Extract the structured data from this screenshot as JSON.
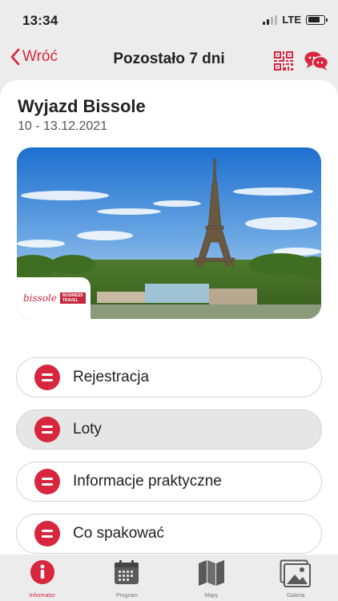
{
  "status_bar": {
    "time": "13:34",
    "network": "LTE"
  },
  "nav": {
    "back_label": "Wróć",
    "title": "Pozostało 7 dni"
  },
  "trip": {
    "title": "Wyjazd Bissole",
    "dates": "10 - 13.12.2021"
  },
  "hero": {
    "logo_word": "bissole",
    "logo_tag_line1": "BUSINESS",
    "logo_tag_line2": "TRAVEL"
  },
  "menu": {
    "items": [
      {
        "label": "Rejestracja",
        "active": false
      },
      {
        "label": "Loty",
        "active": true
      },
      {
        "label": "Informacje praktyczne",
        "active": false
      },
      {
        "label": "Co spakować",
        "active": false
      }
    ]
  },
  "tabs": [
    {
      "label": "Informator",
      "icon": "info-icon",
      "active": true
    },
    {
      "label": "Program",
      "icon": "calendar-icon",
      "active": false
    },
    {
      "label": "Mapy",
      "icon": "map-icon",
      "active": false
    },
    {
      "label": "Galeria",
      "icon": "gallery-icon",
      "active": false
    }
  ],
  "colors": {
    "accent": "#d7263d",
    "background": "#ececec",
    "card": "#ffffff"
  }
}
